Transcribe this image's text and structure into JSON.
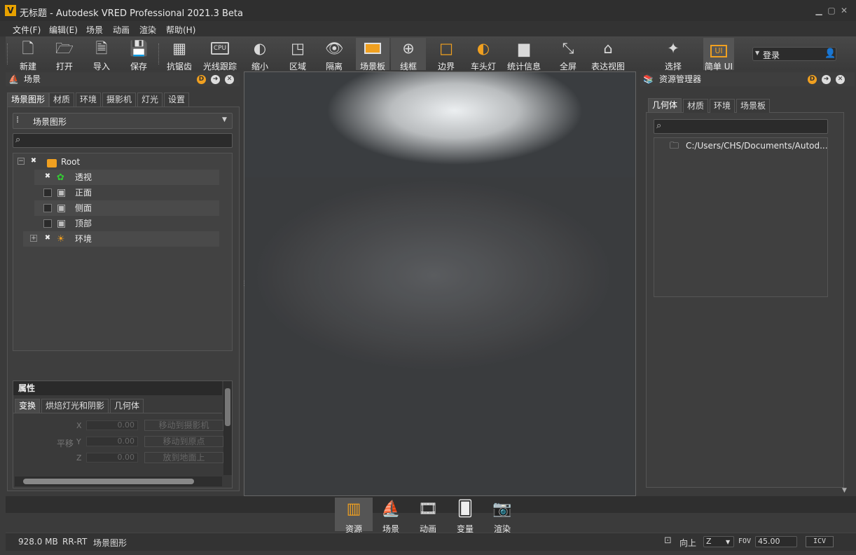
{
  "window": {
    "title": "无标题 - Autodesk VRED Professional 2021.3 Beta",
    "logo_letter": "V"
  },
  "menu": [
    "文件(F)",
    "编辑(E)",
    "场景",
    "动画",
    "渲染",
    "帮助(H)"
  ],
  "toolbar": {
    "new": "新建",
    "open": "打开",
    "import": "导入",
    "save": "保存",
    "antialias": "抗锯齿",
    "raytrace": "光线跟踪",
    "raytrace_chip": "CPU",
    "zoom_out": "缩小",
    "region": "区域",
    "isolate": "隔离",
    "sceneplate": "场景板",
    "wireframe": "线框",
    "bounds": "边界",
    "headlight": "车头灯",
    "stats": "统计信息",
    "fullscreen": "全屏",
    "presentation": "表达视图",
    "select": "选择",
    "simple_ui": "简单 UI",
    "simple_ui_badge": "UI"
  },
  "login": {
    "label": "登录"
  },
  "scene_panel": {
    "title": "场景",
    "tabs": [
      "场景图形",
      "材质",
      "环境",
      "摄影机",
      "灯光",
      "设置"
    ],
    "dropdown_value": "场景图形",
    "search_placeholder": "",
    "tree": [
      {
        "label": "Root",
        "checked": true
      },
      {
        "label": "透视",
        "checked": true
      },
      {
        "label": "正面",
        "checked": false
      },
      {
        "label": "侧面",
        "checked": false
      },
      {
        "label": "顶部",
        "checked": false
      },
      {
        "label": "环境",
        "checked": true
      }
    ]
  },
  "properties": {
    "title": "属性",
    "tabs": [
      "变换",
      "烘焙灯光和阴影",
      "几何体"
    ],
    "translate_label": "平移",
    "axes": [
      "X",
      "Y",
      "Z"
    ],
    "values": [
      "0.00",
      "0.00",
      "0.00"
    ],
    "buttons": [
      "移动到摄影机",
      "移动到原点",
      "放到地面上"
    ]
  },
  "asset_panel": {
    "title": "资源管理器",
    "tabs": [
      "几何体",
      "材质",
      "环境",
      "场景板"
    ],
    "path": "C:/Users/CHS/Documents/Autod..."
  },
  "bottom_tabs": [
    "资源",
    "场景",
    "动画",
    "变量",
    "渲染"
  ],
  "status": {
    "memory": "928.0 MB",
    "mode": "RR-RT",
    "context": "场景图形",
    "up_label": "向上",
    "up_axis": "Z",
    "fov_label": "FOV",
    "fov_value": "45.00",
    "icv": "ICV"
  },
  "colors": {
    "accent": "#f0a020",
    "badge": "#e8a200"
  }
}
